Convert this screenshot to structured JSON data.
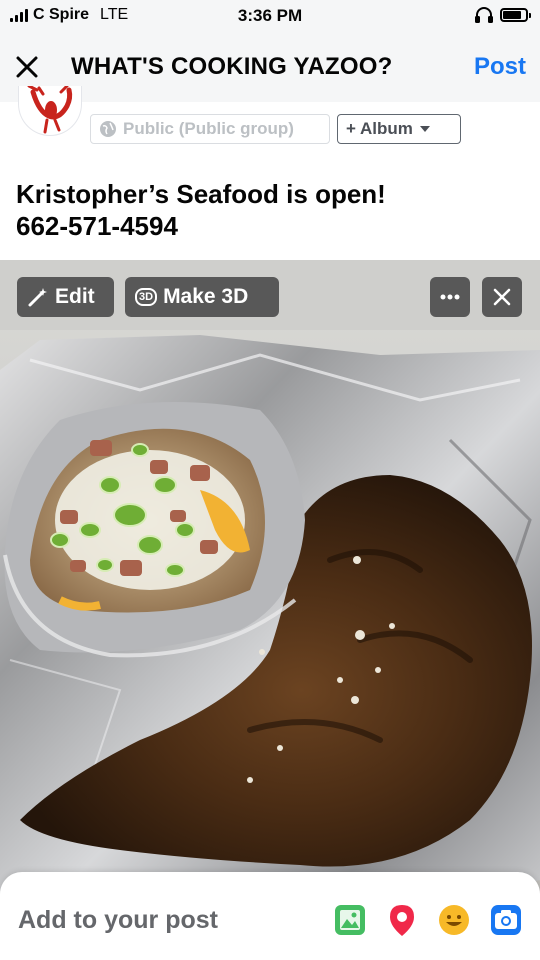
{
  "status_bar": {
    "carrier": "C Spire",
    "network": "LTE",
    "time": "3:36 PM",
    "battery_level": 0.8
  },
  "header": {
    "close_icon": "close-icon",
    "title": "WHAT'S COOKING YAZOO?",
    "post_label": "Post",
    "accent": "#1877f2"
  },
  "composer": {
    "avatar_icon": "crawfish-logo-icon",
    "audience_icon": "globe-icon",
    "audience_label": "Public (Public group)",
    "album_label": "+ Album",
    "album_icon": "caret-down-icon",
    "text_line1": "Kristopher’s Seafood is open!",
    "text_line2": "662-571-4594"
  },
  "photo": {
    "edit_label": "Edit",
    "edit_icon": "magic-wand-icon",
    "make3d_label": "Make 3D",
    "make3d_badge": "3D",
    "more_icon": "more-dots-icon",
    "close_icon": "close-icon"
  },
  "bottom": {
    "add_label": "Add to your post",
    "icons": [
      "photo-icon",
      "location-pin-icon",
      "feeling-emoji-icon",
      "camera-icon"
    ],
    "colors": {
      "photo": "#45bd62",
      "location": "#f02849",
      "feeling": "#f7b928",
      "camera": "#1877f2"
    }
  }
}
